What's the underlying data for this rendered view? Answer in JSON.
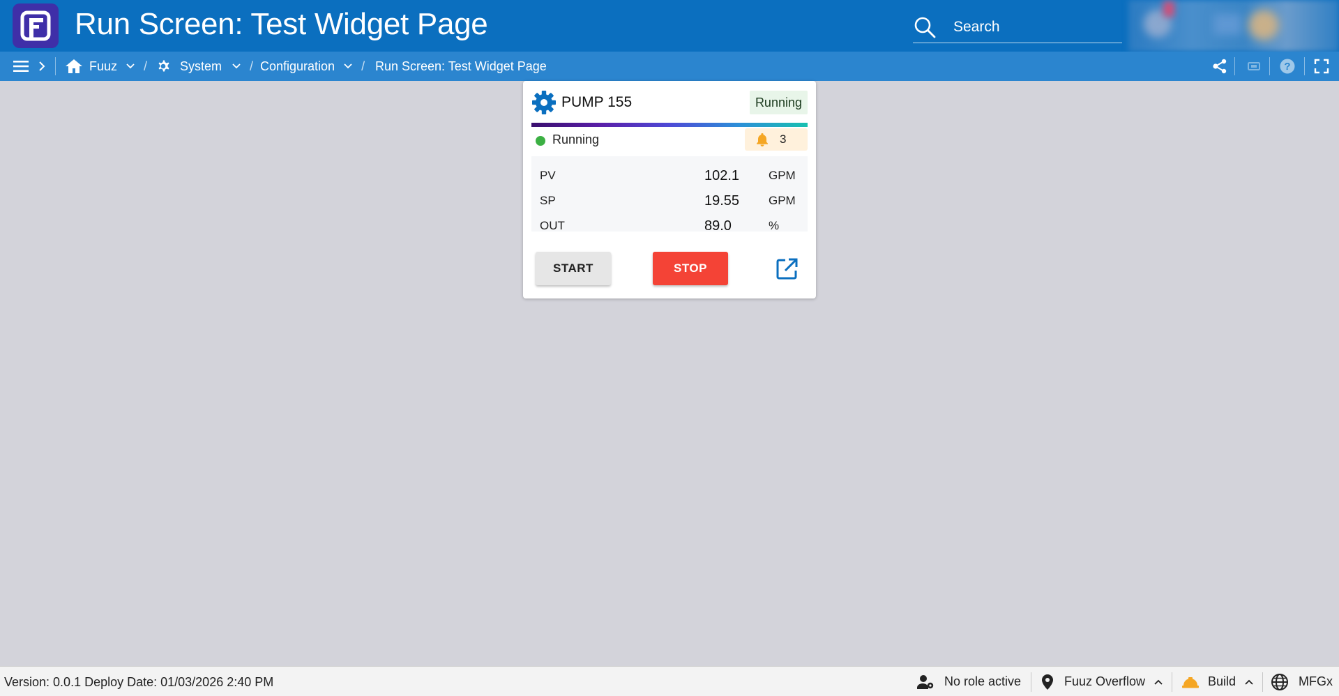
{
  "header": {
    "logo_letter": "F",
    "title": "Run Screen: Test Widget Page",
    "search": {
      "placeholder": "Search",
      "icon": "search-icon"
    },
    "colors": {
      "bar": "#0b6fbf",
      "logo": "#3f2fa8"
    }
  },
  "breadcrumb": {
    "items": [
      {
        "label": "Fuuz",
        "icon": "home-icon"
      },
      {
        "label": "System",
        "icon": "gear-icon"
      },
      {
        "label": "Configuration"
      },
      {
        "label": "Run Screen: Test Widget Page"
      }
    ],
    "separator": "/",
    "right_icons": [
      "share-icon",
      "display-icon",
      "help-icon",
      "fullscreen-icon"
    ]
  },
  "widget": {
    "title": "PUMP 155",
    "status_chip": "Running",
    "state": {
      "label": "Running",
      "color": "#3cb043"
    },
    "alarm": {
      "count": "3",
      "icon": "bell-icon"
    },
    "values": [
      {
        "label": "PV",
        "value": "102.1",
        "unit": "GPM"
      },
      {
        "label": "SP",
        "value": "19.55",
        "unit": "GPM"
      },
      {
        "label": "OUT",
        "value": "89.0",
        "unit": "%"
      }
    ],
    "buttons": {
      "start": "START",
      "stop": "STOP"
    },
    "colors": {
      "stop": "#f44336",
      "accent": "#0b6fbf"
    }
  },
  "footer": {
    "version_text": "Version: 0.0.1 Deploy Date: 01/03/2026 2:40 PM",
    "role": "No role active",
    "location": "Fuuz Overflow",
    "mode": "Build",
    "app": "MFGx"
  }
}
